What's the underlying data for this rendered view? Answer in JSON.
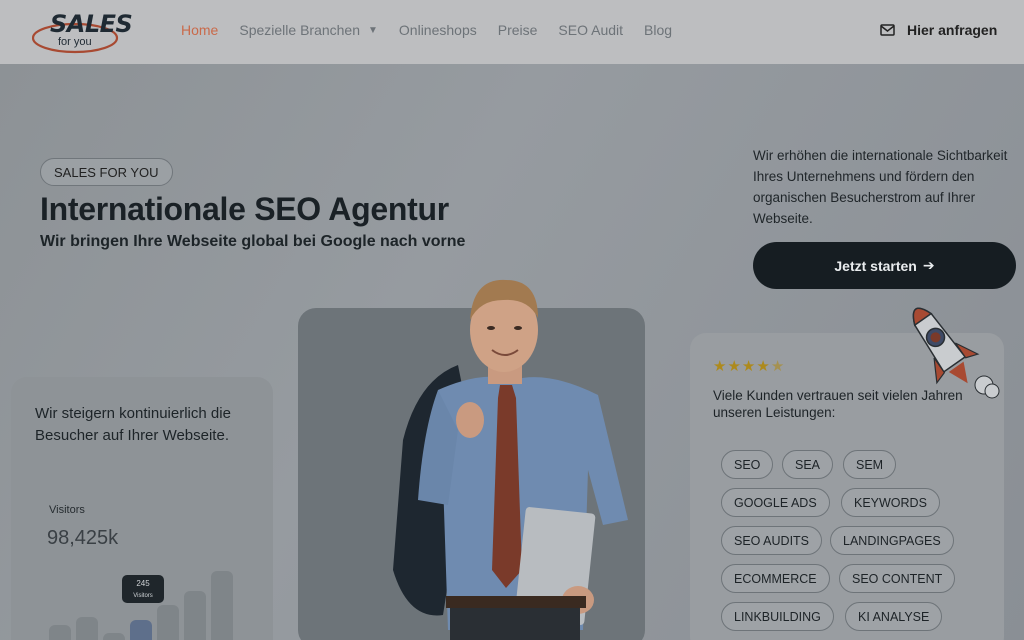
{
  "header": {
    "logo_text": "SALES",
    "logo_sub": "for you",
    "nav": [
      "Home",
      "Spezielle Branchen",
      "Onlineshops",
      "Preise",
      "SEO Audit",
      "Blog"
    ],
    "cta": "Hier anfragen",
    "mail_icon": "envelope-icon"
  },
  "hero": {
    "badge": "SALES FOR YOU",
    "title": "Internationale SEO Agentur",
    "subtitle": "Wir bringen Ihre Webseite global bei Google nach vorne",
    "intro": "Wir erhöhen die internationale Sichtbarkeit Ihres Unternehmens und fördern den organischen Besucherstrom auf Ihrer Webseite.",
    "start_button": "Jetzt starten"
  },
  "stats_card": {
    "text": "Wir steigern kontinuierlich die Besucher auf Ihrer Webseite.",
    "visitors_label": "Visitors",
    "visitors_value": "98,425k",
    "tooltip_value": "245",
    "tooltip_label": "Visitors"
  },
  "reviews_card": {
    "rating": 4.5,
    "text": "Viele Kunden vertrauen seit vielen Jahren unseren Leistungen:",
    "tags": [
      "SEO",
      "SEA",
      "SEM",
      "GOOGLE ADS",
      "KEYWORDS",
      "SEO AUDITS",
      "LANDINGPAGES",
      "ECOMMERCE",
      "SEO CONTENT",
      "LINKBUILDING",
      "KI ANALYSE"
    ]
  },
  "colors": {
    "accent": "#c96a4a",
    "button": "#161d22",
    "star": "#ad8a1d"
  }
}
